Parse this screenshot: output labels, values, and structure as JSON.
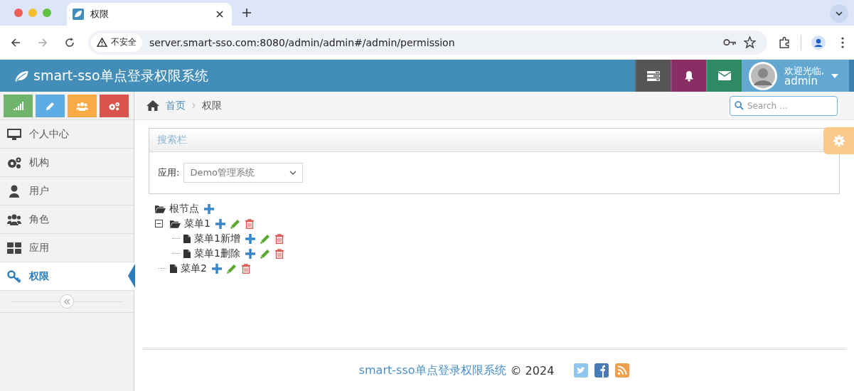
{
  "browser": {
    "tab_title": "权限",
    "url": "server.smart-sso.com:8080/admin/admin#/admin/permission",
    "security_label": "不安全"
  },
  "app": {
    "title": "smart-sso单点登录权限系统",
    "user": {
      "greeting": "欢迎光临,",
      "name": "admin"
    }
  },
  "sidebar": {
    "shortcuts": [
      {
        "kind": "signal",
        "color": "#6fb36c"
      },
      {
        "kind": "pencil",
        "color": "#5eace4"
      },
      {
        "kind": "users",
        "color": "#f8aa45"
      },
      {
        "kind": "gears",
        "color": "#d9534f"
      }
    ],
    "items": [
      {
        "label": "个人中心",
        "kind": "desktop",
        "selected": false
      },
      {
        "label": "机构",
        "kind": "gears",
        "selected": false
      },
      {
        "label": "用户",
        "kind": "user",
        "selected": false
      },
      {
        "label": "角色",
        "kind": "users",
        "selected": false
      },
      {
        "label": "应用",
        "kind": "grid",
        "selected": false
      },
      {
        "label": "权限",
        "kind": "key",
        "selected": true
      }
    ]
  },
  "breadcrumb": [
    {
      "label": "首页"
    },
    {
      "label": "权限"
    }
  ],
  "search": {
    "placeholder": "Search ..."
  },
  "search_panel": {
    "title": "搜索栏",
    "field_label": "应用:",
    "select_value": "Demo管理系统"
  },
  "tree": {
    "label": "根节点",
    "kind": "folder",
    "actions": [
      {
        "kind": "add"
      }
    ],
    "children": [
      {
        "label": "菜单1",
        "kind": "folder",
        "expanded": true,
        "actions": [
          {
            "kind": "add"
          },
          {
            "kind": "edit"
          },
          {
            "kind": "delete"
          }
        ],
        "children": [
          {
            "label": "菜单1新增",
            "kind": "file",
            "actions": [
              {
                "kind": "add"
              },
              {
                "kind": "edit"
              },
              {
                "kind": "delete"
              }
            ]
          },
          {
            "label": "菜单1删除",
            "kind": "file",
            "actions": [
              {
                "kind": "add"
              },
              {
                "kind": "edit"
              },
              {
                "kind": "delete"
              }
            ]
          }
        ]
      },
      {
        "label": "菜单2",
        "kind": "file",
        "actions": [
          {
            "kind": "add"
          },
          {
            "kind": "edit"
          },
          {
            "kind": "delete"
          }
        ]
      }
    ]
  },
  "footer": {
    "brand": "smart-sso单点登录权限系统",
    "copyright": "© 2024"
  }
}
